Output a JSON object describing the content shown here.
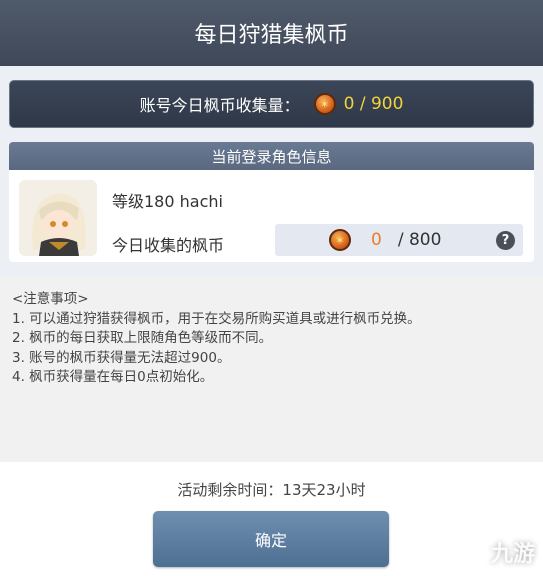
{
  "title": "每日狩猎集枫币",
  "account": {
    "label": "账号今日枫币收集量：",
    "value": "0 / 900",
    "coin_icon": "maple-coin-icon"
  },
  "character": {
    "header": "当前登录角色信息",
    "name": "等级180 hachi",
    "coin_label": "今日收集的枫币",
    "coin_current": "0",
    "coin_max": "/ 800",
    "help_glyph": "?"
  },
  "notes": {
    "title": "<注意事项>",
    "items": [
      "1. 可以通过狩猎获得枫币，用于在交易所购买道具或进行枫币兑换。",
      "2. 枫币的每日获取上限随角色等级而不同。",
      "3. 账号的枫币获得量无法超过900。",
      "4. 枫币获得量在每日0点初始化。"
    ]
  },
  "footer": {
    "remaining": "活动剩余时间：13天23小时",
    "confirm": "确定"
  },
  "watermark": "九游",
  "colors": {
    "titlebar": "#465062",
    "accent_gold": "#f2d33a",
    "accent_orange": "#ef7a28",
    "button": "#5a7ea3"
  }
}
